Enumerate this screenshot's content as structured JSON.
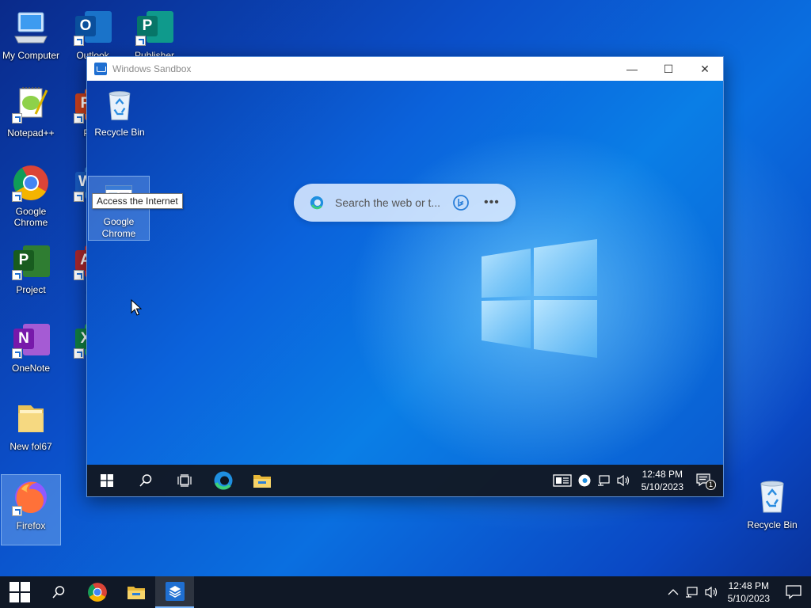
{
  "host_desktop": {
    "icons": [
      {
        "label": "My Computer"
      },
      {
        "label": "Outlook"
      },
      {
        "label": "Publisher"
      },
      {
        "label": "Notepad++"
      },
      {
        "label": "Pow"
      },
      {
        "label": "Google Chrome"
      },
      {
        "label": "W"
      },
      {
        "label": "Project"
      },
      {
        "label": "Ac"
      },
      {
        "label": "OneNote"
      },
      {
        "label": "E"
      },
      {
        "label": "New fol67"
      },
      {
        "label": "Firefox"
      },
      {
        "label": "Recycle Bin"
      }
    ]
  },
  "sandbox": {
    "title": "Windows Sandbox",
    "controls": {
      "minimize": "—",
      "maximize": "☐",
      "close": "✕"
    },
    "icons": [
      {
        "label": "Recycle Bin"
      },
      {
        "label": "Google Chrome"
      }
    ],
    "tooltip": "Access the Internet",
    "search": {
      "placeholder": "Search the web or t..."
    },
    "taskbar": {
      "time": "12:48 PM",
      "date": "5/10/2023",
      "notification_count": "1"
    }
  },
  "host_taskbar": {
    "time": "12:48 PM",
    "date": "5/10/2023"
  },
  "colors": {
    "accent": "#0a6fe0",
    "taskbar": "#101826",
    "edge_blue": "#1f8fe0"
  }
}
